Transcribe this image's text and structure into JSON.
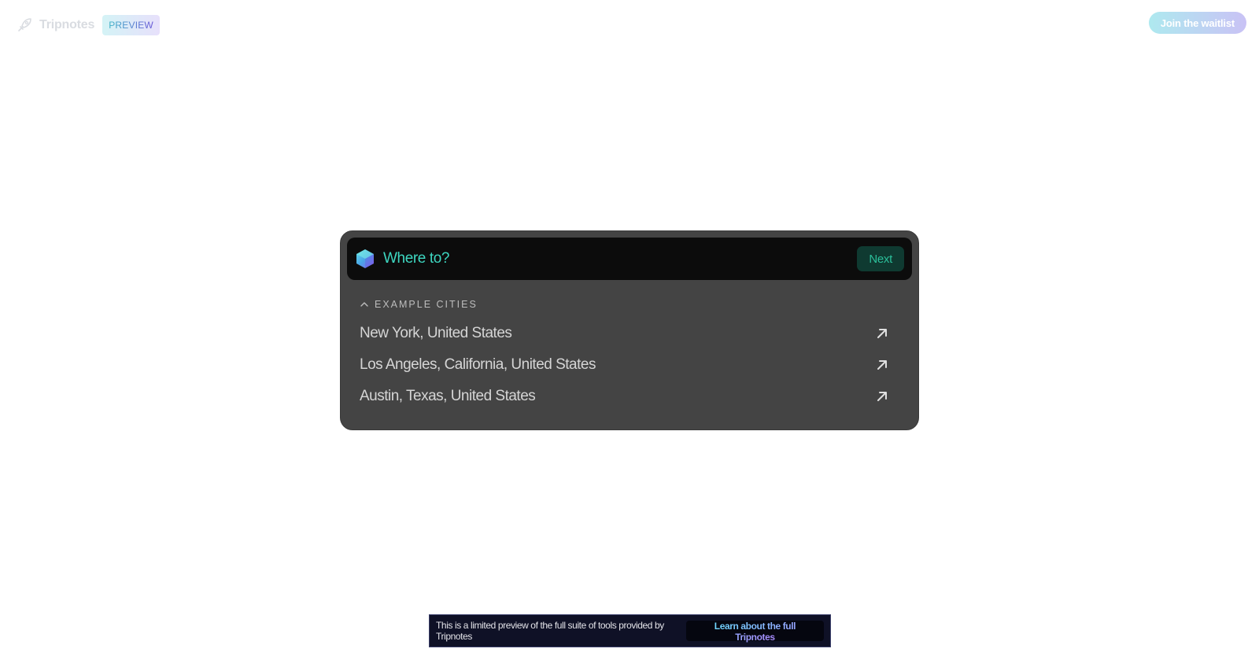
{
  "header": {
    "brand_name": "Tripnotes",
    "badge": "PREVIEW",
    "waitlist_label": "Join the waitlist"
  },
  "search": {
    "placeholder": "Where to?",
    "value": "",
    "next_label": "Next"
  },
  "examples": {
    "title": "EXAMPLE CITIES",
    "cities": [
      {
        "name": "New York, United States"
      },
      {
        "name": "Los Angeles, California, United States"
      },
      {
        "name": "Austin, Texas, United States"
      }
    ]
  },
  "banner": {
    "text": "This is a limited preview of the full suite of tools provided by Tripnotes",
    "cta_label": "Learn about the full Tripnotes"
  },
  "colors": {
    "accent_teal": "#3dd6c0",
    "card_bg": "#444444",
    "banner_bg": "#0f1126"
  },
  "icons": {
    "brand": "rocket-icon",
    "search": "hexagon-gem-icon",
    "toggle": "chevron-up-icon",
    "city": "arrow-up-right-icon"
  }
}
